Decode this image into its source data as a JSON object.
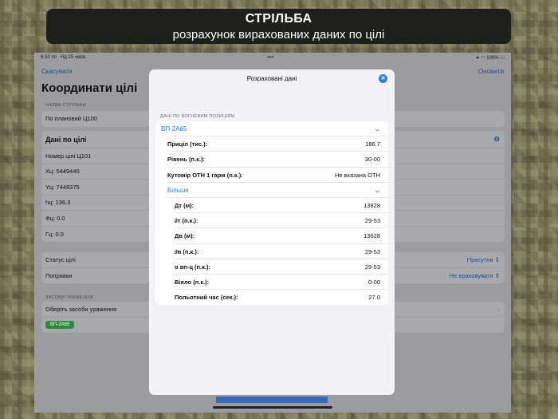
{
  "banner": {
    "title": "СТРІЛЬБА",
    "subtitle": "розрахунок вирахованих даних по цілі"
  },
  "status_bar": {
    "time": "6:32 пп",
    "date": "Нд 25 черв.",
    "battery": "100%"
  },
  "background": {
    "cancel_label": "Скасувати",
    "update_label": "Оновити",
    "page_title": "Координати цілі",
    "fire_name_section": "НАЗВА СТРІЛЬБИ",
    "fire_name_value": "По плановий Ц100",
    "target_data_header": "Дані по цілі",
    "target_fields": [
      "Номер цілі  Ц101",
      "Хц:  5449440",
      "Yц:  7448375",
      "hц:  136.3",
      "Фц:  0.0",
      "Гц:  0.0"
    ],
    "status_label": "Статус цілі",
    "status_value": "Присутня",
    "corrections_label": "Поправки",
    "corrections_value": "Не враховувати",
    "weapons_section": "ЗАСОБИ УРАЖЕННЯ",
    "weapons_prompt": "Оберіть засоби ураження",
    "weapon_chip": "ВП-2А65"
  },
  "modal": {
    "title": "Розраховані дані",
    "section_label": "ДАНІ ПО ВОГНЕВИМ ПОЗИЦІЯМ",
    "position_name": "ВП-2А65",
    "primary_rows": [
      {
        "label": "Приціл (тис.):",
        "value": "186.7"
      },
      {
        "label": "Рівень (п.к.):",
        "value": "30-00"
      },
      {
        "label": "Кутомір ОТН 1 гарм (п.к.):",
        "value": "Не вказана ОТН"
      }
    ],
    "more_label": "Більше",
    "detail_rows": [
      {
        "label": "Дт (м):",
        "value": "13628"
      },
      {
        "label": "∂т (п.к.):",
        "value": "29-53"
      },
      {
        "label": "Дв (м):",
        "value": "13628"
      },
      {
        "label": "∂в (п.к.):",
        "value": "29-53"
      },
      {
        "label": "α вп-ц (п.к.):",
        "value": "29-53"
      },
      {
        "label": "Віяло (п.к.):",
        "value": "0-00"
      },
      {
        "label": "Польотний час (сек.):",
        "value": "27.0"
      }
    ]
  }
}
